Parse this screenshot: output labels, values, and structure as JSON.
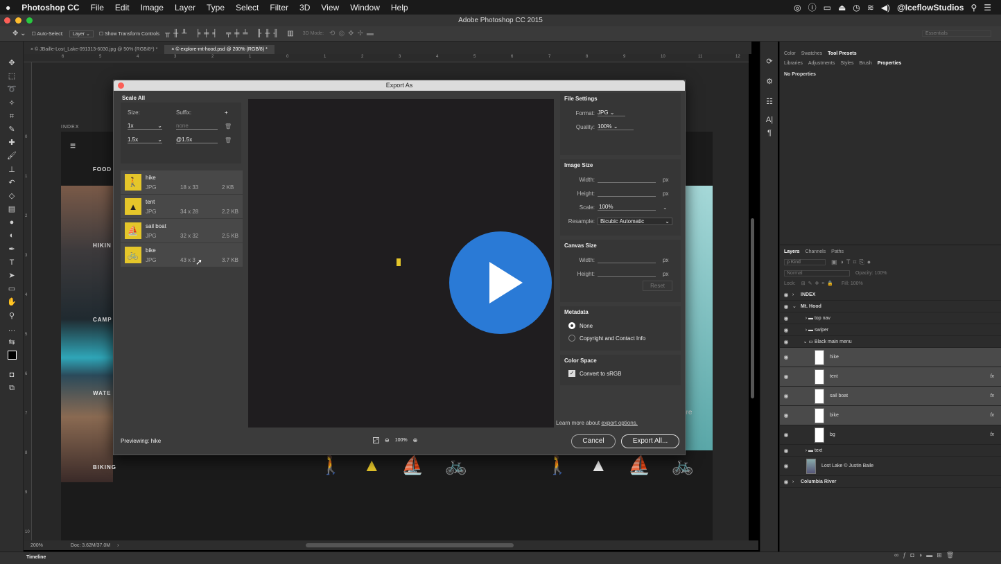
{
  "menubar": {
    "app": "Photoshop CC",
    "items": [
      "File",
      "Edit",
      "Image",
      "Layer",
      "Type",
      "Select",
      "Filter",
      "3D",
      "View",
      "Window",
      "Help"
    ],
    "user": "@IceflowStudios"
  },
  "window": {
    "title": "Adobe Photoshop CC 2015"
  },
  "options_bar": {
    "auto_select": "Auto-Select:",
    "auto_select_value": "Layer",
    "show_transform": "Show Transform Controls",
    "mode_3d": "3D Mode:",
    "workspace": "Essentials"
  },
  "tabs": [
    {
      "label": "© JBaille-Lost_Lake-091313-6030.jpg @ 50% (RGB/8*) *"
    },
    {
      "label": "© explore-mt-hood.psd @ 200% (RGB/8) *"
    }
  ],
  "ruler": {
    "top_ticks": [
      "6",
      "5",
      "4",
      "3",
      "2",
      "1",
      "0",
      "1",
      "2",
      "3",
      "4",
      "5",
      "6",
      "7",
      "8",
      "9",
      "10",
      "11",
      "12"
    ],
    "left_ticks": [
      "0",
      "1",
      "2",
      "3",
      "4",
      "5",
      "6",
      "7",
      "8",
      "9",
      "10"
    ]
  },
  "status": {
    "zoom": "200%",
    "doc": "Doc: 3.62M/37.0M"
  },
  "timeline": {
    "label": "Timeline"
  },
  "canvas": {
    "index_label": "INDEX",
    "food_label": "FOOD",
    "nav_labels": [
      "HIKIN",
      "CAMP",
      "WATE",
      "BIKING"
    ],
    "more_label": "ore"
  },
  "dialog": {
    "title": "Export As",
    "scale_all": "Scale All",
    "size_label": "Size:",
    "suffix_label": "Suffix:",
    "add": "+",
    "scales": [
      {
        "size": "1x",
        "suffix": "none"
      },
      {
        "size": "1.5x",
        "suffix": "@1.5x"
      }
    ],
    "assets": [
      {
        "name": "hike",
        "format": "JPG",
        "dims": "18 x 33",
        "size": "2 KB",
        "glyph": "🚶"
      },
      {
        "name": "tent",
        "format": "JPG",
        "dims": "34 x 28",
        "size": "2.2 KB",
        "glyph": "▲"
      },
      {
        "name": "sail boat",
        "format": "JPG",
        "dims": "32 x 32",
        "size": "2.5 KB",
        "glyph": "⛵"
      },
      {
        "name": "bike",
        "format": "JPG",
        "dims": "43 x 3",
        "size": "3.7 KB",
        "glyph": "🚲"
      }
    ],
    "file_settings": "File Settings",
    "format_label": "Format:",
    "format_value": "JPG",
    "quality_label": "Quality:",
    "quality_value": "100%",
    "image_size": "Image Size",
    "width_label": "Width:",
    "height_label": "Height:",
    "scale_label": "Scale:",
    "scale_value": "100%",
    "resample_label": "Resample:",
    "resample_value": "Bicubic Automatic",
    "px": "px",
    "canvas_size": "Canvas Size",
    "reset": "Reset",
    "metadata": "Metadata",
    "meta_none": "None",
    "meta_copyright": "Copyright and Contact Info",
    "color_space": "Color Space",
    "convert_srgb": "Convert to sRGB",
    "learn_more": "Learn more about",
    "learn_link": "export options.",
    "previewing": "Previewing: hike",
    "zoom": "100%",
    "cancel": "Cancel",
    "export_all": "Export All..."
  },
  "panels": {
    "top_tabs_1": [
      "Color",
      "Swatches",
      "Tool Presets"
    ],
    "top_tabs_2": [
      "Libraries",
      "Adjustments",
      "Styles",
      "Brush",
      "Properties"
    ],
    "no_properties": "No Properties",
    "layer_tabs": [
      "Layers",
      "Channels",
      "Paths"
    ],
    "kind": "ρ Kind",
    "blend": "Normal",
    "opacity": "Opacity: 100%",
    "lock": "Lock:",
    "fill": "Fill: 100%",
    "layers": [
      {
        "name": "INDEX",
        "bold": true
      },
      {
        "name": "Mt. Hood",
        "bold": true
      },
      {
        "name": "top nav"
      },
      {
        "name": "swiper"
      },
      {
        "name": "Black main menu"
      },
      {
        "name": "hike",
        "thumb": true
      },
      {
        "name": "tent",
        "thumb": true,
        "fx": "fx"
      },
      {
        "name": "sail boat",
        "thumb": true,
        "fx": "fx"
      },
      {
        "name": "bike",
        "thumb": true,
        "fx": "fx"
      },
      {
        "name": "bg",
        "thumb": true,
        "fx": "fx"
      },
      {
        "name": "text"
      },
      {
        "name": "Lost Lake © Justin Baile",
        "thumb": true
      },
      {
        "name": "Columbia River",
        "bold": true
      }
    ]
  },
  "colors": {
    "accent": "#2a7ad6",
    "icon_yellow": "#e5c62a"
  }
}
